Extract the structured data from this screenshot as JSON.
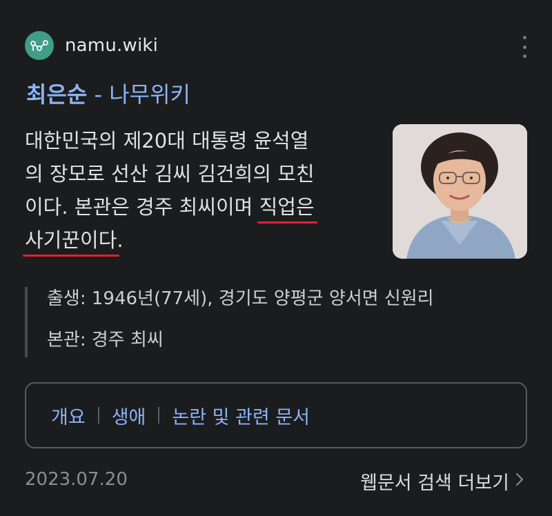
{
  "source": {
    "site_name": "namu.wiki",
    "favicon_icon": "namu-wiki-logo-icon",
    "favicon_color": "#3f9d88",
    "menu_icon": "vertical-ellipsis-icon"
  },
  "result": {
    "title_bold": "최은순",
    "title_rest": " - 나무위키",
    "link_color": "#8ab4f8",
    "snippet": {
      "line1": "대한민국의 제20대 대통령 윤석열",
      "line2": "의 장모로 선산 김씨 김건희의 모친",
      "line3_a": "이다. 본관은 경주 최씨이며 ",
      "line3_hl": "직업은",
      "line4_hl": "사기꾼이다",
      "line4_end": "."
    },
    "underline_color": "#e3232c"
  },
  "facts": [
    {
      "text": "출생: 1946년(77세), 경기도 양평군 양서면 신원리"
    },
    {
      "text": "본관: 경주 최씨"
    }
  ],
  "sections": [
    {
      "label": "개요"
    },
    {
      "label": "생애"
    },
    {
      "label": "논란 및 관련 문서"
    }
  ],
  "footer": {
    "date": "2023.07.20",
    "more_label": "웹문서 검색 더보기",
    "more_icon": "chevron-right-icon"
  }
}
